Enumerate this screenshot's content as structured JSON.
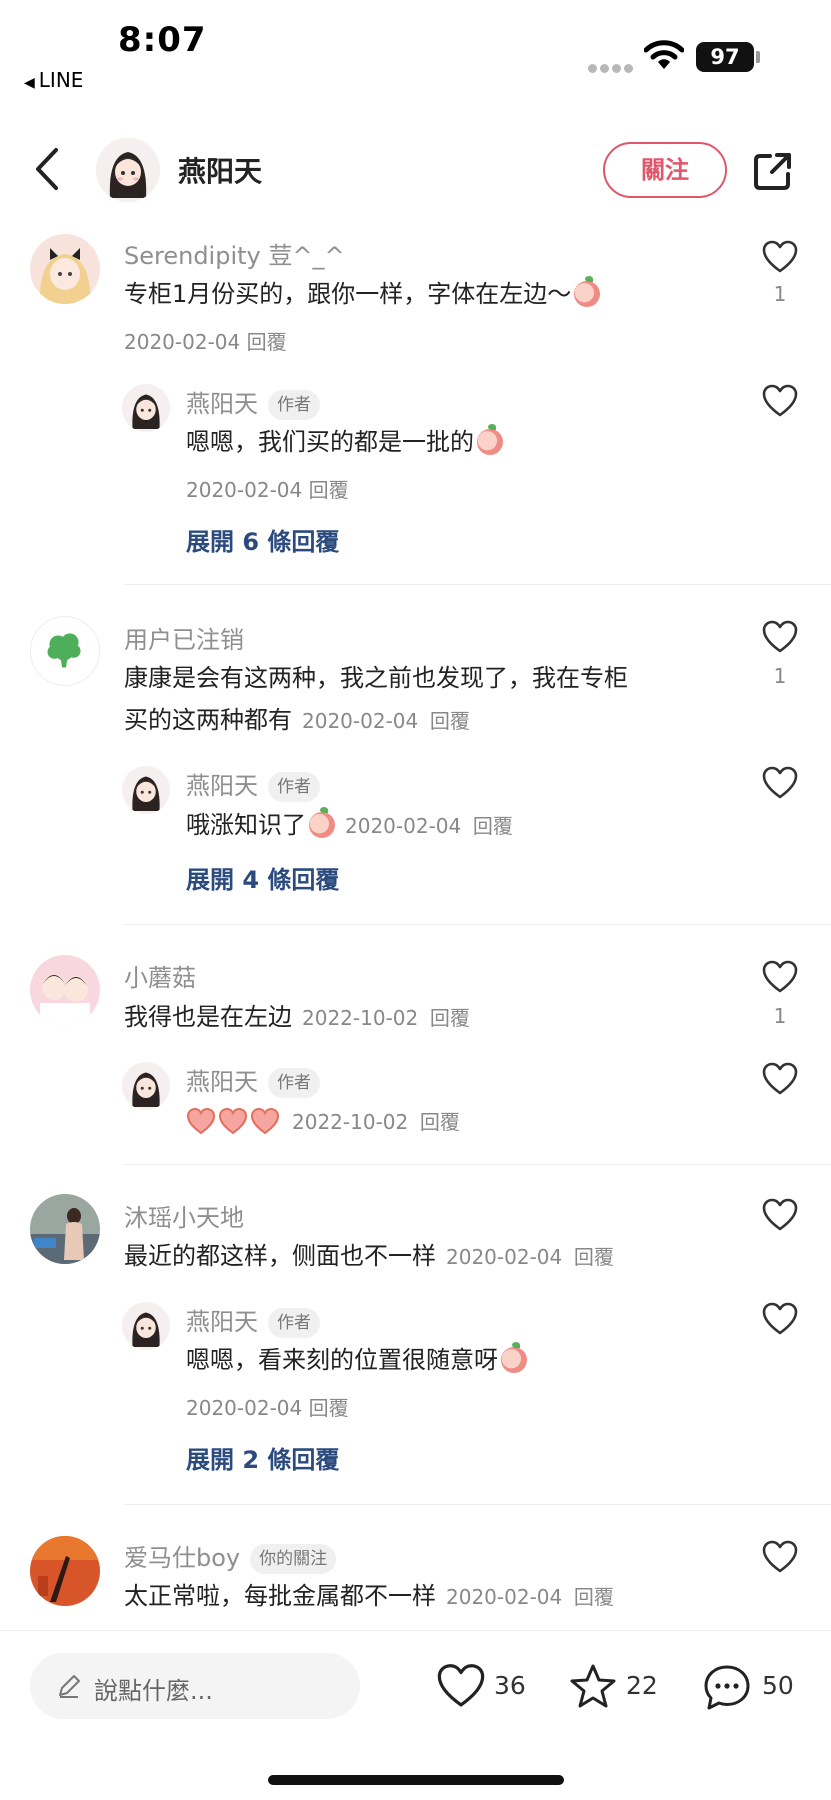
{
  "status_bar": {
    "time": "8:07",
    "back_app": "LINE",
    "battery": "97"
  },
  "header": {
    "name": "燕阳天",
    "follow_label": "關注"
  },
  "comments": [
    {
      "user": "Serendipity 荳^_^",
      "text": "专柜1月份买的，跟你一样，字体在左边～",
      "date": "2020-02-04",
      "reply_label": "回覆",
      "likes": "1",
      "reply": {
        "user": "燕阳天",
        "tag": "作者",
        "text": "嗯嗯，我们买的都是一批的",
        "date": "2020-02-04",
        "reply_label": "回覆"
      },
      "expand": "展開 6 條回覆"
    },
    {
      "user": "用户已注销",
      "text_line1": "康康是会有这两种，我之前也发现了，我在专柜",
      "text_line2": "买的这两种都有",
      "date": "2020-02-04",
      "reply_label": "回覆",
      "likes": "1",
      "reply": {
        "user": "燕阳天",
        "tag": "作者",
        "text": "哦涨知识了",
        "date": "2020-02-04",
        "reply_label": "回覆"
      },
      "expand": "展開 4 條回覆"
    },
    {
      "user": "小蘑菇",
      "text": "我得也是在左边",
      "date": "2022-10-02",
      "reply_label": "回覆",
      "likes": "1",
      "reply": {
        "user": "燕阳天",
        "tag": "作者",
        "date": "2022-10-02",
        "reply_label": "回覆"
      }
    },
    {
      "user": "沐瑶小天地",
      "text": "最近的都这样，侧面也不一样",
      "date": "2020-02-04",
      "reply_label": "回覆",
      "reply": {
        "user": "燕阳天",
        "tag": "作者",
        "text": "嗯嗯，看来刻的位置很随意呀",
        "date": "2020-02-04",
        "reply_label": "回覆"
      },
      "expand": "展開 2 條回覆"
    },
    {
      "user": "爱马仕boy",
      "tag": "你的關注",
      "text": "太正常啦，每批金属都不一样",
      "date": "2020-02-04",
      "reply_label": "回覆"
    }
  ],
  "bottom_bar": {
    "input_placeholder": "說點什麼...",
    "likes": "36",
    "favorites": "22",
    "comments": "50"
  },
  "colors": {
    "accent": "#e0566b",
    "link": "#2b4a7e",
    "muted": "#888888"
  },
  "icons": [
    "back-chevron-icon",
    "share-icon",
    "heart-outline-icon",
    "star-outline-icon",
    "chat-bubble-icon",
    "pencil-icon",
    "wifi-icon"
  ]
}
